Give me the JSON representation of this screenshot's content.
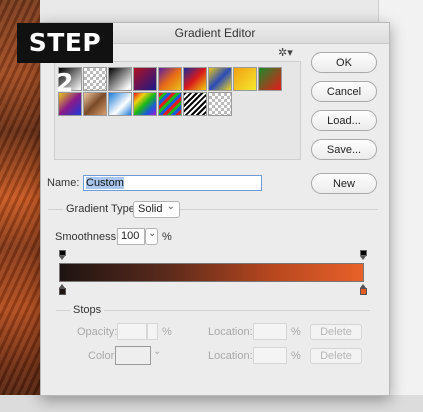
{
  "badge": {
    "text": "STEP 2"
  },
  "dialog": {
    "title": "Gradient Editor"
  },
  "buttons": {
    "ok": "OK",
    "cancel": "Cancel",
    "load": "Load...",
    "save": "Save...",
    "new": "New"
  },
  "name": {
    "label": "Name:",
    "value": "Custom"
  },
  "gradient_type": {
    "label": "Gradient Type:",
    "value": "Solid",
    "chevron": "⌄"
  },
  "smoothness": {
    "label": "Smoothness:",
    "value": "100",
    "unit": "%"
  },
  "stops": {
    "label": "Stops",
    "opacity_label": "Opacity:",
    "opacity_unit": "%",
    "location_label": "Location:",
    "location_unit": "%",
    "color_label": "Color:",
    "delete_label": "Delete"
  },
  "colors": {
    "gradient_start": "#1e1412",
    "gradient_end": "#e8612a",
    "stop_end": "#f05a24"
  }
}
